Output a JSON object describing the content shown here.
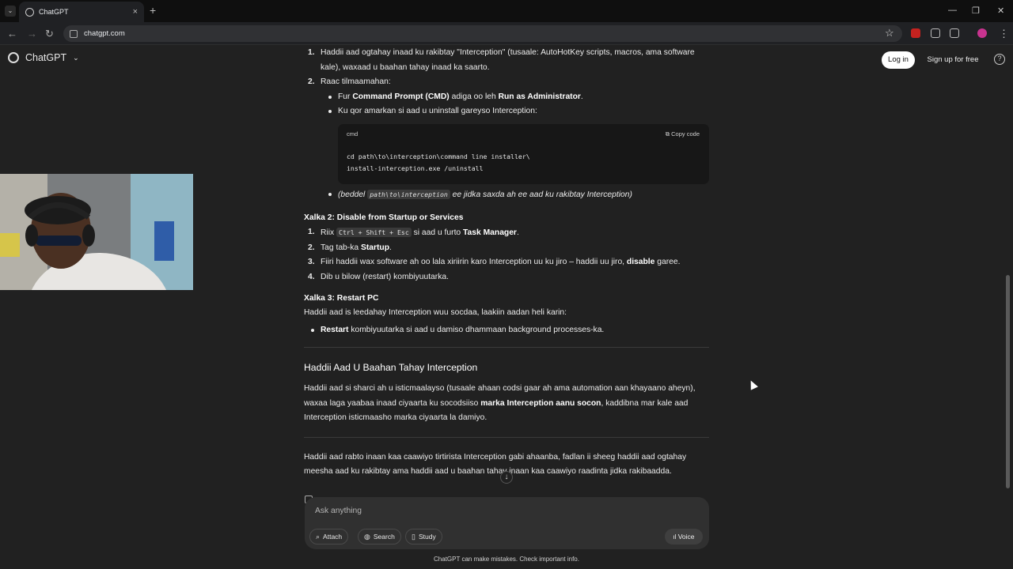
{
  "browser": {
    "tab_title": "ChatGPT",
    "tab_close": "×",
    "new_tab": "+",
    "url": "chatgpt.com",
    "win_min": "—",
    "win_max": "❐",
    "win_close": "✕"
  },
  "header": {
    "logo_text": "ChatGPT",
    "login_label": "Log in",
    "signup_label": "Sign up for free",
    "help": "?"
  },
  "content": {
    "step1_n": "1.",
    "step1": "Haddii aad ogtahay inaad ku rakibtay \"Interception\" (tusaale: AutoHotKey scripts, macros, ama software kale), waxaad u baahan tahay inaad ka saarto.",
    "step2_n": "2.",
    "step2": "Raac tilmaamahan:",
    "b1_pre": "Fur ",
    "b1_bold1": "Command Prompt (CMD)",
    "b1_mid": " adiga oo leh ",
    "b1_bold2": "Run as Administrator",
    "b1_post": ".",
    "b2": "Ku qor amarkan si aad u uninstall gareyso Interception:",
    "code_lang": "cmd",
    "code_copy": "⧉ Copy code",
    "code_line1": "cd path\\to\\interception\\command line installer\\",
    "code_line2": "install-interception.exe /uninstall",
    "b3_open": "(beddel ",
    "b3_code": "path\\to\\interception",
    "b3_rest": " ee jidka saxda ah ee aad ku rakibtay Interception)",
    "xalka2_title": "Xalka 2: Disable from Startup or Services",
    "x2_1_n": "1.",
    "x2_1_pre": "Riix ",
    "x2_1_code": "Ctrl + Shift + Esc",
    "x2_1_mid": " si aad u furto ",
    "x2_1_bold": "Task Manager",
    "x2_1_post": ".",
    "x2_2_n": "2.",
    "x2_2_pre": "Tag tab-ka ",
    "x2_2_bold": "Startup",
    "x2_2_post": ".",
    "x2_3_n": "3.",
    "x2_3_pre": "Fiiri haddii wax software ah oo lala xiriirin karo Interception uu ku jiro – haddii uu jiro, ",
    "x2_3_bold": "disable",
    "x2_3_post": " garee.",
    "x2_4_n": "4.",
    "x2_4": "Dib u bilow (restart) kombiyuutarka.",
    "xalka3_title": "Xalka 3: Restart PC",
    "x3_intro": "Haddii aad is leedahay Interception wuu socdaa, laakiin aadan heli karin:",
    "x3_bold": "Restart",
    "x3_rest": " kombiyuutarka si aad u damiso dhammaan background processes-ka.",
    "section_title": "Haddii Aad U Baahan Tahay Interception",
    "para1_pre": "Haddii aad si sharci ah u isticmaalayso (tusaale ahaan codsi gaar ah ama automation aan khayaano aheyn), waxaa laga yaabaa inaad ciyaarta ku socodsiiso ",
    "para1_bold": "marka Interception aanu socon",
    "para1_post": ", kaddibna mar kale aad Interception isticmaasho marka ciyaarta la damiyo.",
    "para2": "Haddii aad rabto inaan kaa caawiyo tirtirista Interception gabi ahaanba, fadlan ii sheeg haddii aad ogtahay meesha aad ku rakibtay ama haddii aad u baahan tahay inaan kaa caawiyo raadinta jidka rakibaadda."
  },
  "composer": {
    "placeholder": "Ask anything",
    "attach": "Attach",
    "search": "Search",
    "study": "Study",
    "voice": "Voice"
  },
  "footer": {
    "disclaimer": "ChatGPT can make mistakes. Check important info."
  }
}
